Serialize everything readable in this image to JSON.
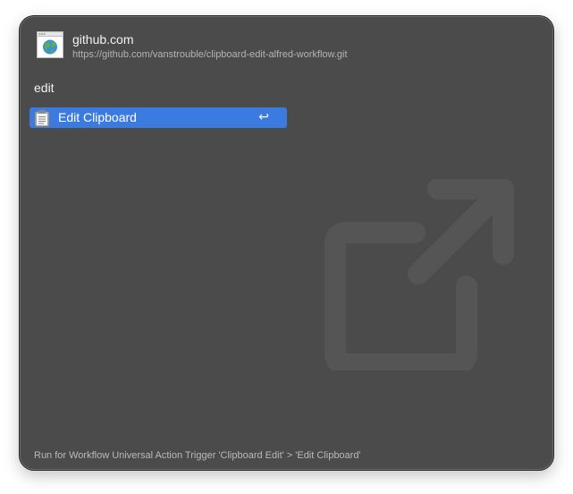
{
  "header": {
    "title": "github.com",
    "url": "https://github.com/vanstrouble/clipboard-edit-alfred-workflow.git",
    "icon": "browser-window-globe-icon"
  },
  "search": {
    "query": "edit"
  },
  "results": [
    {
      "label": "Edit Clipboard",
      "icon": "clipboard-icon",
      "shortcut": "↩",
      "selected": true
    }
  ],
  "background_icon": "open-external-icon",
  "footer": {
    "text": "Run for Workflow Universal Action Trigger 'Clipboard Edit' > 'Edit Clipboard'"
  },
  "colors": {
    "panel": "#4b4b4b",
    "selection": "#3b7bdf",
    "text": "#f2f2f2",
    "muted": "#b4b4b4"
  }
}
